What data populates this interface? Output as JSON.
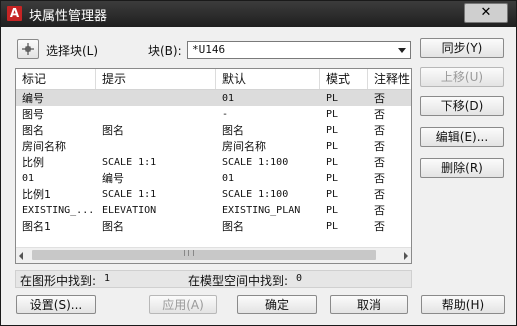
{
  "window": {
    "title": "块属性管理器",
    "icon_letter": "A",
    "close_icon": "close-x-icon",
    "brand_color": "#c62424"
  },
  "toolbar": {
    "pick_icon": "crosshair-pick-icon",
    "select_block_label": "选择块(L)",
    "block_label": "块(B):",
    "block_value": "*U146"
  },
  "side_buttons": {
    "sync": "同步(Y)",
    "move_up": "上移(U)",
    "move_down": "下移(D)",
    "edit": "编辑(E)...",
    "delete": "删除(R)"
  },
  "table": {
    "columns": [
      "标记",
      "提示",
      "默认",
      "模式",
      "注释性"
    ],
    "rows": [
      [
        "编号",
        "",
        "01",
        "PL",
        "否"
      ],
      [
        "图号",
        "",
        "-",
        "PL",
        "否"
      ],
      [
        "图名",
        "图名",
        "图名",
        "PL",
        "否"
      ],
      [
        "房间名称",
        "",
        "房间名称",
        "PL",
        "否"
      ],
      [
        "比例",
        "SCALE 1:1",
        "SCALE 1:100",
        "PL",
        "否"
      ],
      [
        "01",
        "编号",
        "01",
        "PL",
        "否"
      ],
      [
        "比例1",
        "SCALE 1:1",
        "SCALE 1:100",
        "PL",
        "否"
      ],
      [
        "EXISTING_...",
        "ELEVATION",
        "EXISTING_PLAN",
        "PL",
        "否"
      ],
      [
        "图名1",
        "图名",
        "图名",
        "PL",
        "否"
      ]
    ],
    "selected_row_index": 0
  },
  "status": {
    "found_in_drawing_label": "在图形中找到:",
    "found_in_drawing_value": "1",
    "found_in_modelspace_label": "在模型空间中找到:",
    "found_in_modelspace_value": "0"
  },
  "footer": {
    "settings": "设置(S)...",
    "apply": "应用(A)",
    "ok": "确定",
    "cancel": "取消",
    "help": "帮助(H)"
  }
}
